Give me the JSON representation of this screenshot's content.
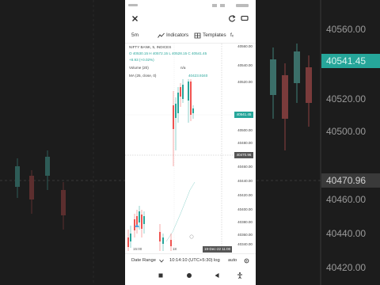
{
  "background": {
    "prices": [
      "40560.00",
      "40520.00",
      "40500.00",
      "40460.00",
      "40440.00",
      "40420.00"
    ],
    "last_price_tag": "40541.45",
    "crosshair_price_tag": "40470.96",
    "colors": {
      "green": "#26a69a",
      "red": "#ef5350",
      "bg": "#1c1c1c"
    }
  },
  "app_bar": {
    "close_icon": "close-icon",
    "refresh_icon": "refresh-icon",
    "fullscreen_icon": "fullscreen-icon"
  },
  "toolbar": {
    "interval": "5m",
    "indicators_label": "Indicators",
    "templates_label": "Templates",
    "more_label": "fₓ"
  },
  "legend": {
    "symbol": "NIFTY BANK, 5, INDICES",
    "ohlc": "O 40530.15  H 40572.15  L 40528.15  C 40541.45",
    "change": "+8.93 (+0.02%)",
    "volume_label": "Volume (20)",
    "volume_value": "n/a",
    "ma_label": "MA (25, close, 0)",
    "ma_value": "40423.9340"
  },
  "price_axis": {
    "labels": [
      "40560.00",
      "40540.00",
      "40520.00",
      "40500.00",
      "40480.00",
      "40460.00",
      "40440.00",
      "40420.00",
      "40400.00",
      "40380.00",
      "40360.00",
      "40340.00"
    ],
    "last_price_tag": "40541.45",
    "crosshair_tag": "40470.96"
  },
  "time_axis": {
    "labels": [
      "15:00",
      "18",
      "19-Dec-22  11:00"
    ]
  },
  "bottom_bar": {
    "date_range_label": "Date Range",
    "timezone_label": "10:14:10 (UTC+5:30)",
    "log_label": "log",
    "auto_label": "auto"
  },
  "nav_bar": {
    "icons": [
      "recents-icon",
      "home-icon",
      "back-icon",
      "accessibility-icon"
    ]
  }
}
